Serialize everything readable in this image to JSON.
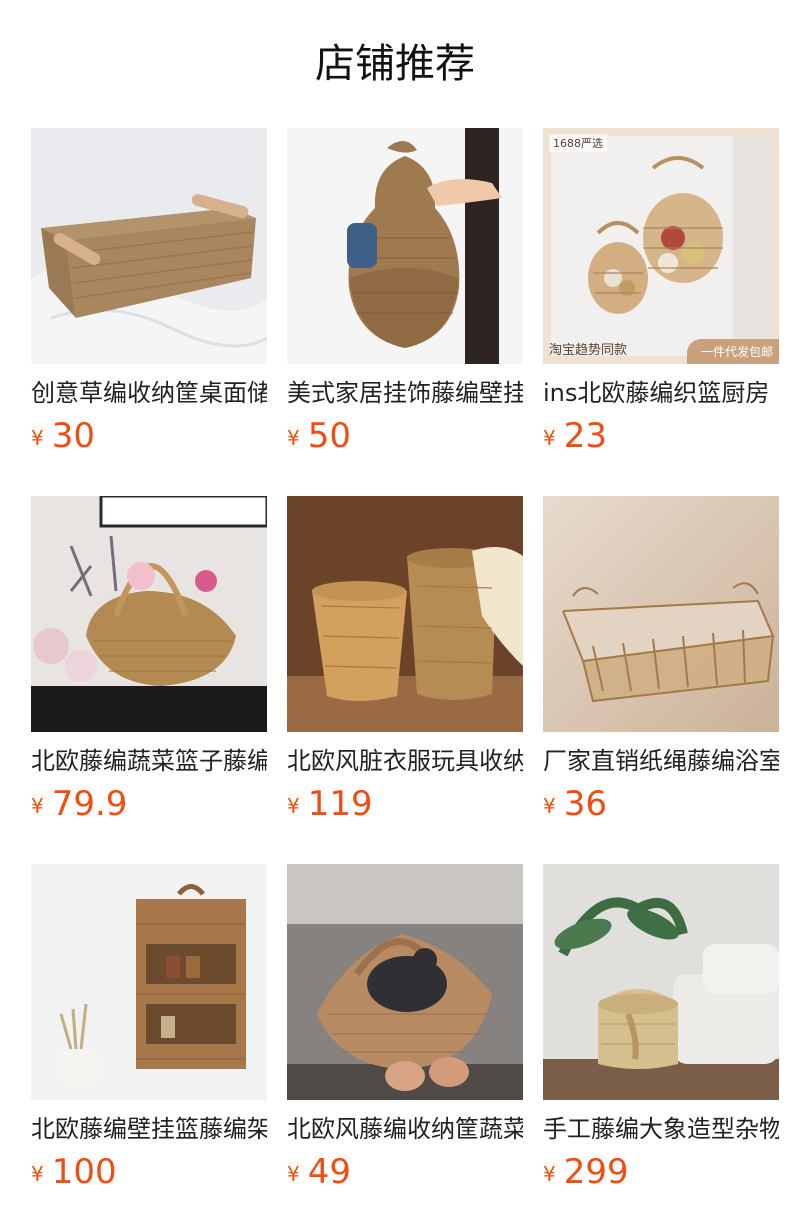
{
  "page": {
    "title": "店铺推荐",
    "currency_symbol": "¥"
  },
  "products": [
    {
      "name": "创意草编收纳筐桌面储物",
      "price": "30",
      "image_icon": "rectangular-handle-basket-image"
    },
    {
      "name": "美式家居挂饰藤编壁挂",
      "price": "50",
      "image_icon": "pear-wall-basket-image"
    },
    {
      "name": "ins北欧藤编织篮厨房",
      "price": "23",
      "image_icon": "hanging-onion-baskets-image",
      "badges": {
        "top": "1688严选",
        "bottom_left": "淘宝趋势同款",
        "bottom_right": "一件代发包邮"
      }
    },
    {
      "name": "北欧藤编蔬菜篮子藤编",
      "price": "79.9",
      "image_icon": "flower-basket-image"
    },
    {
      "name": "北欧风脏衣服玩具收纳",
      "price": "119",
      "image_icon": "laundry-hampers-image"
    },
    {
      "name": "厂家直销纸绳藤编浴室",
      "price": "36",
      "image_icon": "wire-tray-basket-image"
    },
    {
      "name": "北欧藤编壁挂篮藤编架",
      "price": "100",
      "image_icon": "wall-shelf-basket-image"
    },
    {
      "name": "北欧风藤编收纳筐蔬菜",
      "price": "49",
      "image_icon": "hen-basket-image"
    },
    {
      "name": "手工藤编大象造型杂物",
      "price": "299",
      "image_icon": "elephant-basket-image"
    }
  ]
}
